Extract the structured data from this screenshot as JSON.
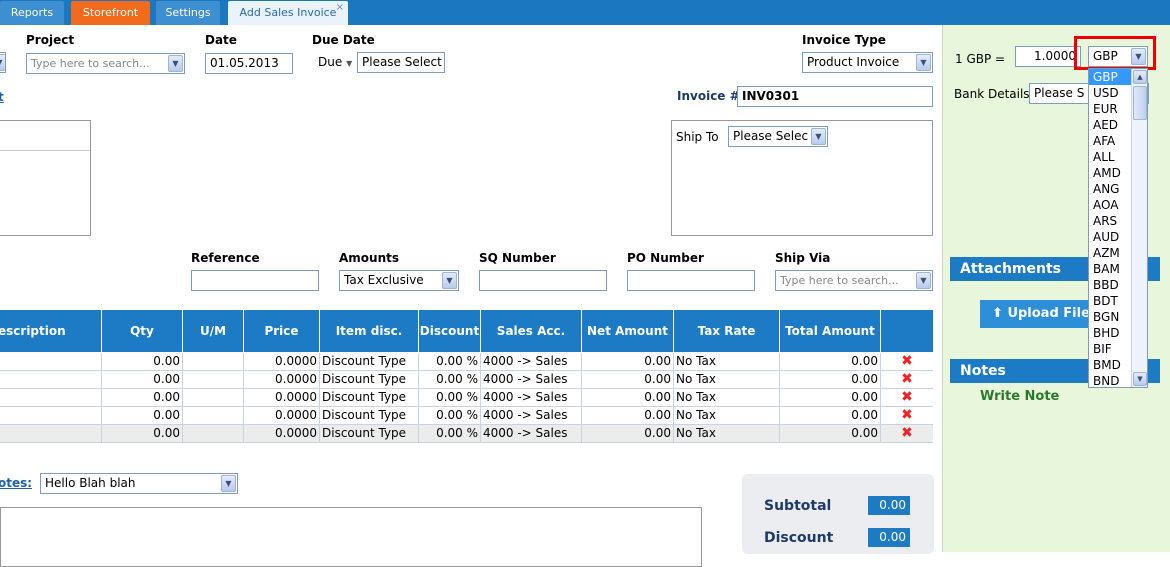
{
  "tabs": [
    {
      "label": "Reports"
    },
    {
      "label": "Storefront"
    },
    {
      "label": "Settings"
    },
    {
      "label": "Add Sales Invoice",
      "close": "×"
    }
  ],
  "form": {
    "project_label": "Project",
    "project_placeholder": "Type here to search...",
    "date_label": "Date",
    "date_value": "01.05.2013",
    "due_date_label": "Due Date",
    "due_value": "Due",
    "due_select": "Please Select",
    "invoice_type_label": "Invoice Type",
    "invoice_type_value": "Product Invoice",
    "invoice_no_label": "Invoice #",
    "invoice_no_value": "INV0301",
    "ship_to_label": "Ship To",
    "ship_to_value": "Please Selec",
    "reference_label": "Reference",
    "amounts_label": "Amounts",
    "amounts_value": "Tax Exclusive",
    "sq_label": "SQ Number",
    "po_label": "PO Number",
    "ship_via_label": "Ship Via",
    "ship_via_placeholder": "Type here to search...",
    "link_fragment": "t"
  },
  "table": {
    "headers": [
      "escription",
      "Qty",
      "U/M",
      "Price",
      "Item disc.",
      "Discount",
      "Sales Acc.",
      "Net Amount",
      "Tax Rate",
      "Total Amount",
      ""
    ],
    "rows": [
      {
        "qty": "0.00",
        "price": "0.0000",
        "item_disc": "Discount Type",
        "discount": "0.00 %",
        "sales_acc": "4000 -> Sales",
        "net": "0.00",
        "tax": "No Tax",
        "total": "0.00"
      },
      {
        "qty": "0.00",
        "price": "0.0000",
        "item_disc": "Discount Type",
        "discount": "0.00 %",
        "sales_acc": "4000 -> Sales",
        "net": "0.00",
        "tax": "No Tax",
        "total": "0.00"
      },
      {
        "qty": "0.00",
        "price": "0.0000",
        "item_disc": "Discount Type",
        "discount": "0.00 %",
        "sales_acc": "4000 -> Sales",
        "net": "0.00",
        "tax": "No Tax",
        "total": "0.00"
      },
      {
        "qty": "0.00",
        "price": "0.0000",
        "item_disc": "Discount Type",
        "discount": "0.00 %",
        "sales_acc": "4000 -> Sales",
        "net": "0.00",
        "tax": "No Tax",
        "total": "0.00"
      },
      {
        "qty": "0.00",
        "price": "0.0000",
        "item_disc": "Discount Type",
        "discount": "0.00 %",
        "sales_acc": "4000 -> Sales",
        "net": "0.00",
        "tax": "No Tax",
        "total": "0.00"
      }
    ],
    "delete_glyph": "✖"
  },
  "notes_section": {
    "label": "otes:",
    "select_value": "Hello Blah blah"
  },
  "totals": {
    "subtotal_label": "Subtotal",
    "subtotal_value": "0.00",
    "discount_label": "Discount",
    "discount_value": "0.00"
  },
  "sidebar": {
    "rate_label": "1 GBP =",
    "rate_value": "1.0000",
    "currency_value": "GBP",
    "bank_label": "Bank Details",
    "bank_value": "Please S",
    "attachments_title": "Attachments",
    "upload_label": "Upload File",
    "upload_icon": "⬆",
    "notes_title": "Notes",
    "write_note": "Write Note"
  },
  "currencies": [
    "GBP",
    "USD",
    "EUR",
    "AED",
    "AFA",
    "ALL",
    "AMD",
    "ANG",
    "AOA",
    "ARS",
    "AUD",
    "AZM",
    "BAM",
    "BBD",
    "BDT",
    "BGN",
    "BHD",
    "BIF",
    "BMD",
    "BND"
  ],
  "colors": {
    "header_blue": "#1d7ac5",
    "tab_orange": "#f26b1d",
    "sidebar_green": "#e8f7dc",
    "highlight_red": "#e00000"
  }
}
